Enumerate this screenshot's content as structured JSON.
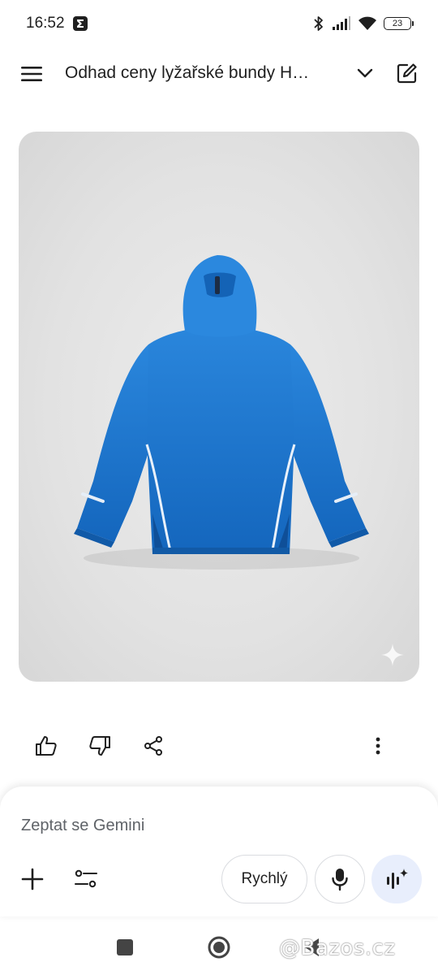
{
  "status_bar": {
    "time": "16:52",
    "app_icon": "sigma-notification-icon",
    "icons": [
      "bluetooth-icon",
      "signal-icon",
      "wifi-icon"
    ],
    "battery_level": "23"
  },
  "header": {
    "title": "Odhad ceny lyžařské bundy H…",
    "menu_icon": "hamburger-menu-icon",
    "dropdown_icon": "chevron-down-icon",
    "new_chat_icon": "edit-icon"
  },
  "image": {
    "description_icon": "sparkle-icon",
    "jacket_color": "#1a73c8"
  },
  "actions": {
    "icons": [
      "thumbs-up-icon",
      "thumbs-down-icon",
      "share-icon",
      "more-vert-icon"
    ]
  },
  "prompt": {
    "placeholder": "Zeptat se Gemini",
    "model_label": "Rychlý",
    "icons": [
      "plus-icon",
      "tools-icon",
      "mic-icon",
      "live-icon"
    ]
  },
  "watermark": {
    "text": "@Bazos.cz"
  },
  "colors": {
    "accent": "#1a73e8",
    "live_button_bg": "#e8eefc",
    "card_bg": "#e4e4e4"
  }
}
